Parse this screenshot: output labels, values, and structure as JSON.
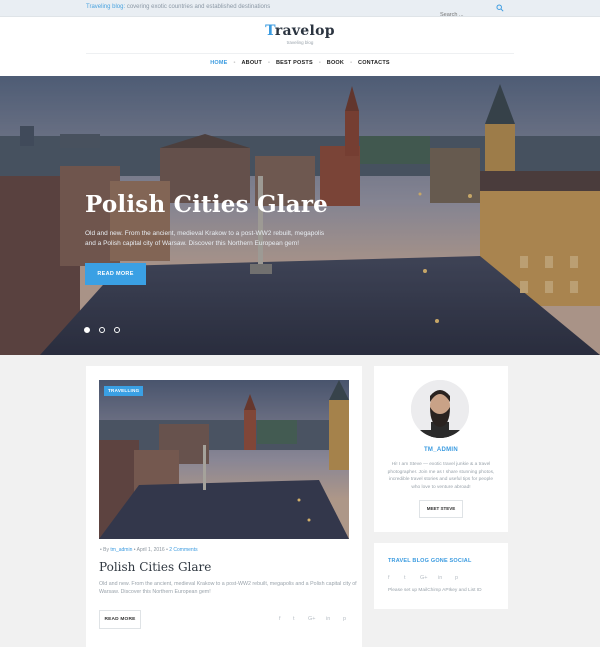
{
  "topbar": {
    "tagline_highlight": "Traveling blog:",
    "tagline_rest": "covering exotic countries and established destinations",
    "search_placeholder": "Search ..."
  },
  "header": {
    "logo_first": "T",
    "logo_rest": "ravelop",
    "logo_subtitle": "traveling blog"
  },
  "nav": {
    "items": [
      "HOME",
      "ABOUT",
      "BEST POSTS",
      "BOOK",
      "CONTACTS"
    ],
    "active_index": 0
  },
  "hero": {
    "title": "Polish Cities Glare",
    "description": "Old and new. From the ancient, medieval Krakow to a post-WW2 rebuilt, megapolis and a Polish capital city of Warsaw. Discover this Northern European gem!",
    "button": "READ MORE",
    "slides": 3,
    "active_slide": 0
  },
  "post": {
    "category": "TRAVELLING",
    "meta_by": "By",
    "meta_author": "tm_admin",
    "meta_date": "April 1, 2016",
    "meta_comments": "2 Comments",
    "title": "Polish Cities Glare",
    "excerpt": "Old and new. From the ancient, medieval Krakow to a post-WW2 rebuilt, megapolis and a Polish capital city of Warsaw. Discover this Northern European gem!",
    "button": "READ MORE",
    "share_icons": [
      "f",
      "t",
      "G+",
      "in",
      "p"
    ]
  },
  "author": {
    "name": "TM_ADMIN",
    "bio": "Hi! I am Steve — exotic travel junkie & a travel photographer. Join me as I share stunning photos, incredible travel stories and useful tips for people who love to venture abroad!",
    "button": "MEET STEVE"
  },
  "social_widget": {
    "heading": "TRAVEL BLOG GONE SOCIAL",
    "icons": [
      "f",
      "t",
      "G+",
      "in",
      "p"
    ],
    "note": "Please set up MailChimp APIkey and List ID"
  },
  "colors": {
    "accent": "#3aa0e4",
    "dark_text": "#2f3740",
    "page_bg": "#f1f1f1"
  }
}
